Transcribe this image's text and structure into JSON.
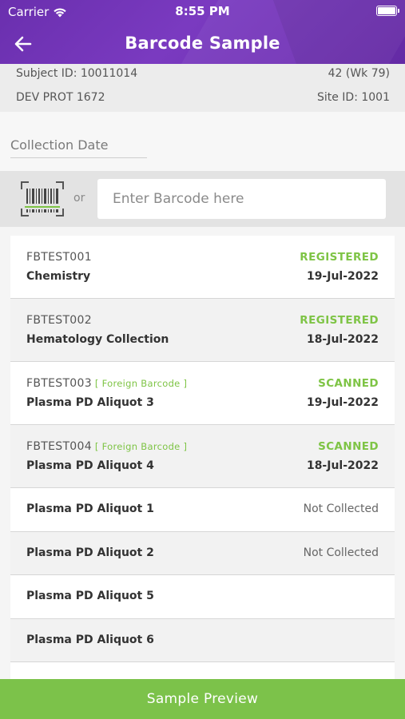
{
  "status_bar": {
    "carrier": "Carrier",
    "time": "8:55 PM"
  },
  "nav": {
    "title": "Barcode Sample"
  },
  "subject": {
    "subject_id": "Subject ID: 10011014",
    "visit": "42 (Wk 79)",
    "protocol": "DEV PROT 1672",
    "site_id": "Site ID: 1001"
  },
  "collection_date": {
    "placeholder": "Collection Date"
  },
  "scan": {
    "or_label": "or",
    "placeholder": "Enter Barcode here"
  },
  "colors": {
    "header": "#7033b4",
    "registered": "#7ec445",
    "scanned": "#7ec445",
    "preview_button": "#7cc24a"
  },
  "samples": [
    {
      "barcode": "FBTEST001",
      "foreign": "",
      "name": "Chemistry",
      "status": "REGISTERED",
      "date": "19-Jul-2022"
    },
    {
      "barcode": "FBTEST002",
      "foreign": "",
      "name": "Hematology Collection",
      "status": "REGISTERED",
      "date": "18-Jul-2022"
    },
    {
      "barcode": "FBTEST003",
      "foreign": "[ Foreign Barcode ]",
      "name": "Plasma PD Aliquot 3",
      "status": "SCANNED",
      "date": "19-Jul-2022"
    },
    {
      "barcode": "FBTEST004",
      "foreign": "[ Foreign Barcode ]",
      "name": "Plasma PD Aliquot 4",
      "status": "SCANNED",
      "date": "18-Jul-2022"
    },
    {
      "name": "Plasma PD Aliquot 1",
      "status": "Not Collected"
    },
    {
      "name": "Plasma PD Aliquot 2",
      "status": "Not Collected"
    },
    {
      "name": "Plasma PD Aliquot 5",
      "status": ""
    },
    {
      "name": "Plasma PD Aliquot 6",
      "status": ""
    }
  ],
  "footer": {
    "preview_label": "Sample Preview"
  }
}
